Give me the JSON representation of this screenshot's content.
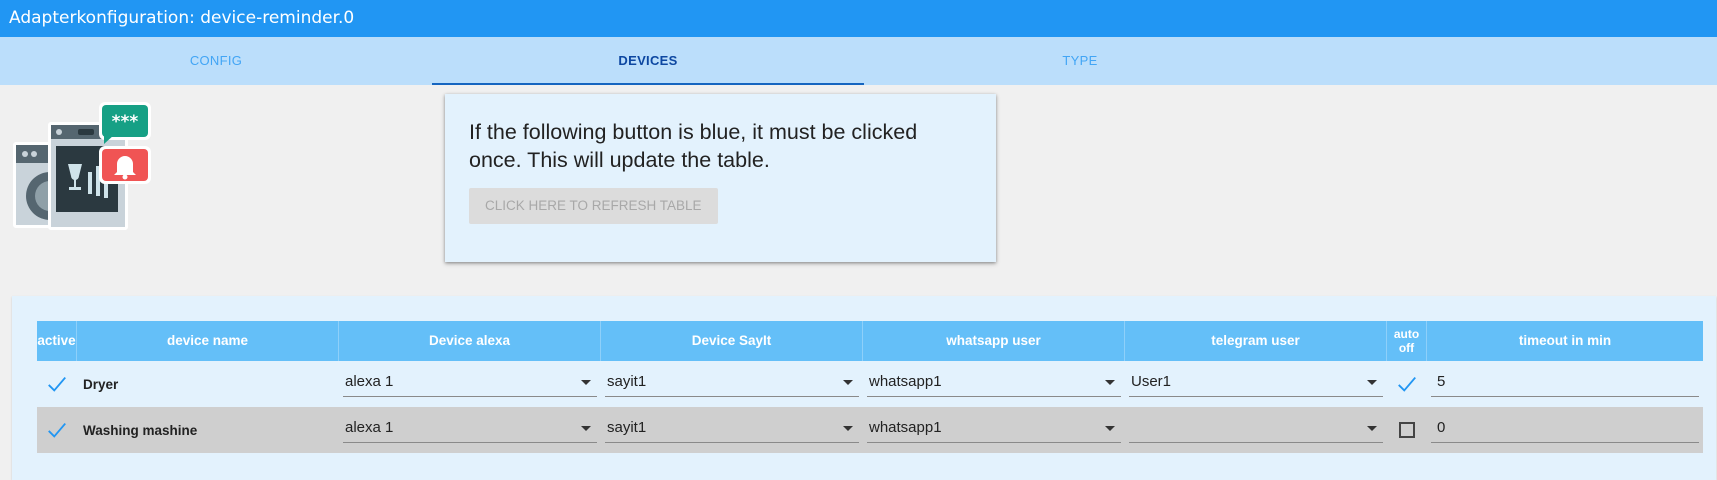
{
  "window": {
    "title": "Adapterkonfiguration: device-reminder.0"
  },
  "tabs": [
    {
      "label": "CONFIG"
    },
    {
      "label": "DEVICES"
    },
    {
      "label": "TYPE"
    }
  ],
  "logo": {
    "icon": "washing-machine-reminder-logo",
    "bubble_text": "***"
  },
  "info": {
    "text": "If the following button is blue, it must be clicked once. This will update the table.",
    "button_label": "CLICK HERE TO REFRESH TABLE"
  },
  "table": {
    "headers": {
      "active": "active",
      "device_name": "device name",
      "device_alexa": "Device alexa",
      "device_sayit": "Device SayIt",
      "whatsapp_user": "whatsapp user",
      "telegram_user": "telegram user",
      "auto_off": "auto off",
      "timeout": "timeout in min"
    },
    "rows": [
      {
        "active": true,
        "device_name": "Dryer",
        "alexa": "alexa 1",
        "sayit": "sayit1",
        "whatsapp": "whatsapp1",
        "telegram": "User1",
        "auto_off": true,
        "timeout": "5"
      },
      {
        "active": true,
        "device_name": "Washing mashine",
        "alexa": "alexa 1",
        "sayit": "sayit1",
        "whatsapp": "whatsapp1",
        "telegram": "",
        "auto_off": false,
        "timeout": "0"
      }
    ]
  },
  "colors": {
    "titlebar": "#2196f3",
    "tabs_bg": "#bbdefb",
    "header_bg": "#64bff8",
    "check": "#2196f3"
  }
}
